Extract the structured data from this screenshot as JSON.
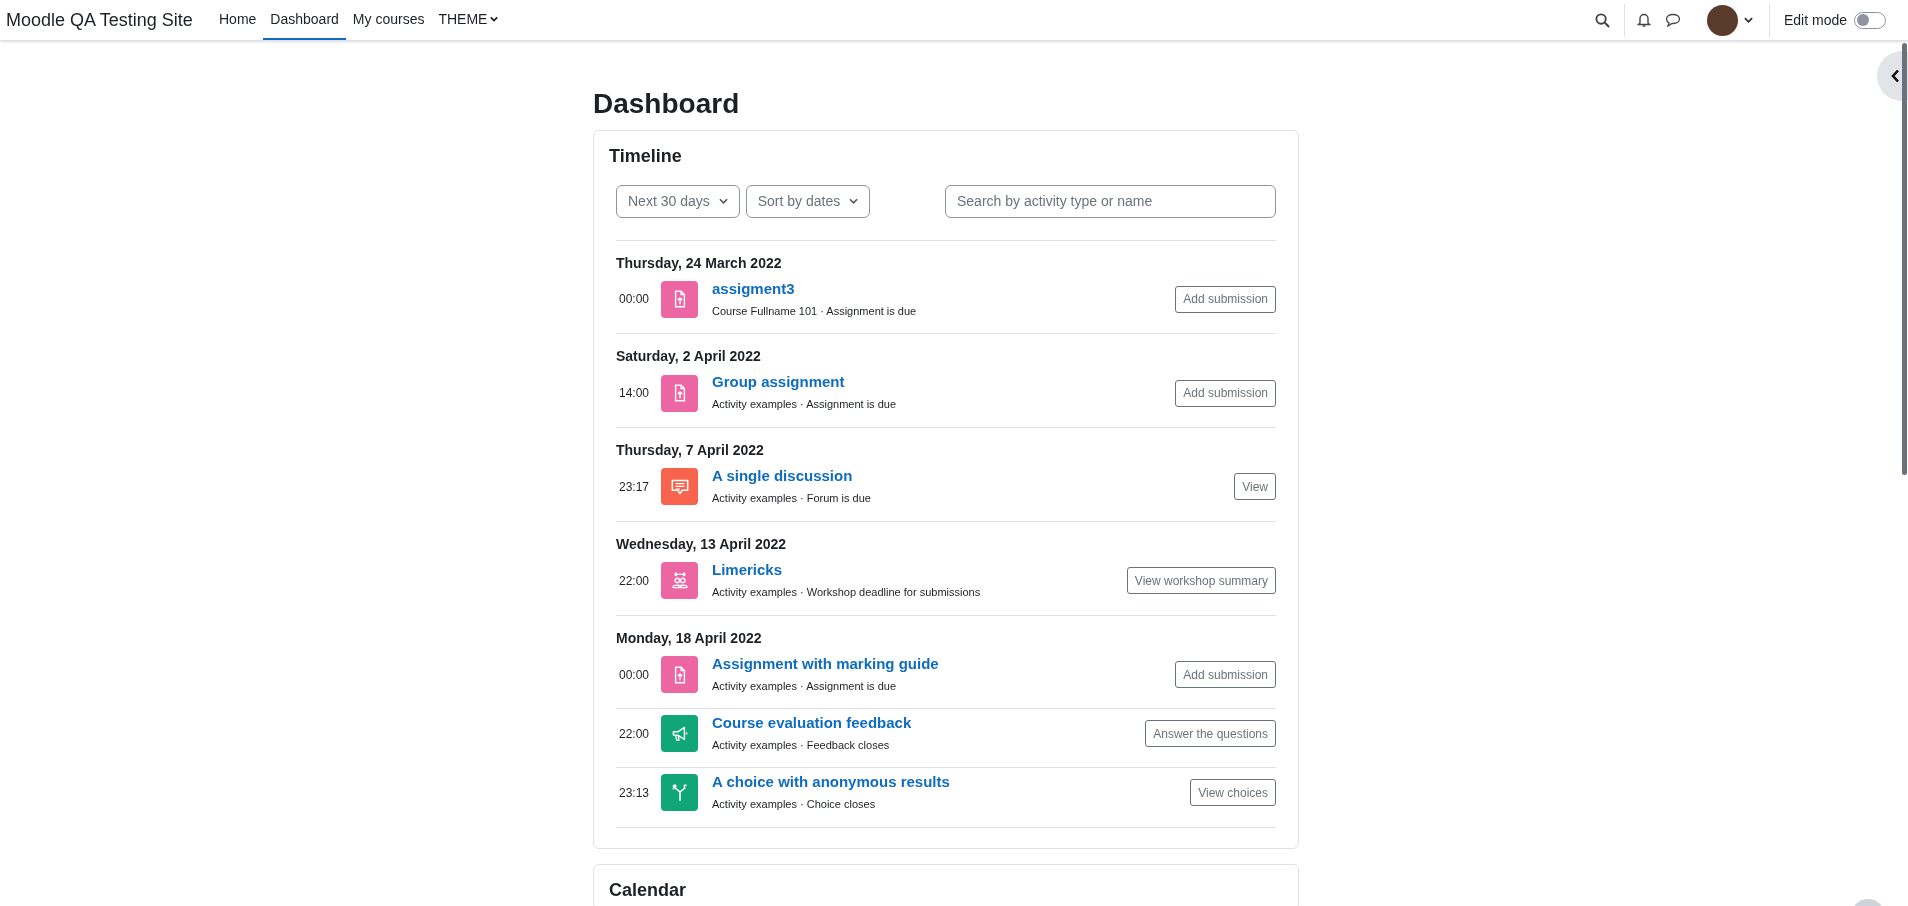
{
  "navbar": {
    "site_name": "Moodle QA Testing Site",
    "items": [
      {
        "label": "Home",
        "selected": false
      },
      {
        "label": "Dashboard",
        "selected": true
      },
      {
        "label": "My courses",
        "selected": false
      },
      {
        "label": "THEME",
        "selected": false,
        "dropdown": true
      }
    ],
    "edit_mode": {
      "label": "Edit mode",
      "on": false
    }
  },
  "page_title": "Dashboard",
  "timeline": {
    "title": "Timeline",
    "filter": "Next 30 days",
    "sort": "Sort by dates",
    "search": {
      "placeholder": "Search by activity type or name"
    },
    "groups": [
      {
        "date": "Thursday, 24 March 2022",
        "events": [
          {
            "time": "00:00",
            "kind": "assignment",
            "color": "#eb66a2",
            "name": "assigment3",
            "details": "Course Fullname 101 · Assignment is due",
            "action": "Add submission"
          }
        ]
      },
      {
        "date": "Saturday, 2 April 2022",
        "events": [
          {
            "time": "14:00",
            "kind": "assignment",
            "color": "#eb66a2",
            "name": "Group assignment",
            "details": "Activity examples · Assignment is due",
            "action": "Add submission"
          }
        ]
      },
      {
        "date": "Thursday, 7 April 2022",
        "events": [
          {
            "time": "23:17",
            "kind": "forum",
            "color": "#f7634d",
            "name": "A single discussion",
            "details": "Activity examples · Forum is due",
            "action": "View"
          }
        ]
      },
      {
        "date": "Wednesday, 13 April 2022",
        "events": [
          {
            "time": "22:00",
            "kind": "workshop",
            "color": "#eb66a2",
            "name": "Limericks",
            "details": "Activity examples · Workshop deadline for submissions",
            "action": "View workshop summary"
          }
        ]
      },
      {
        "date": "Monday, 18 April 2022",
        "events": [
          {
            "time": "00:00",
            "kind": "assignment",
            "color": "#eb66a2",
            "name": "Assignment with marking guide",
            "details": "Activity examples · Assignment is due",
            "action": "Add submission"
          },
          {
            "time": "22:00",
            "kind": "feedback",
            "color": "#11a676",
            "name": "Course evaluation feedback",
            "details": "Activity examples · Feedback closes",
            "action": "Answer the questions"
          },
          {
            "time": "23:13",
            "kind": "choice",
            "color": "#11a676",
            "name": "A choice with anonymous results",
            "details": "Activity examples · Choice closes",
            "action": "View choices"
          }
        ]
      }
    ]
  },
  "calendar": {
    "title": "Calendar"
  }
}
